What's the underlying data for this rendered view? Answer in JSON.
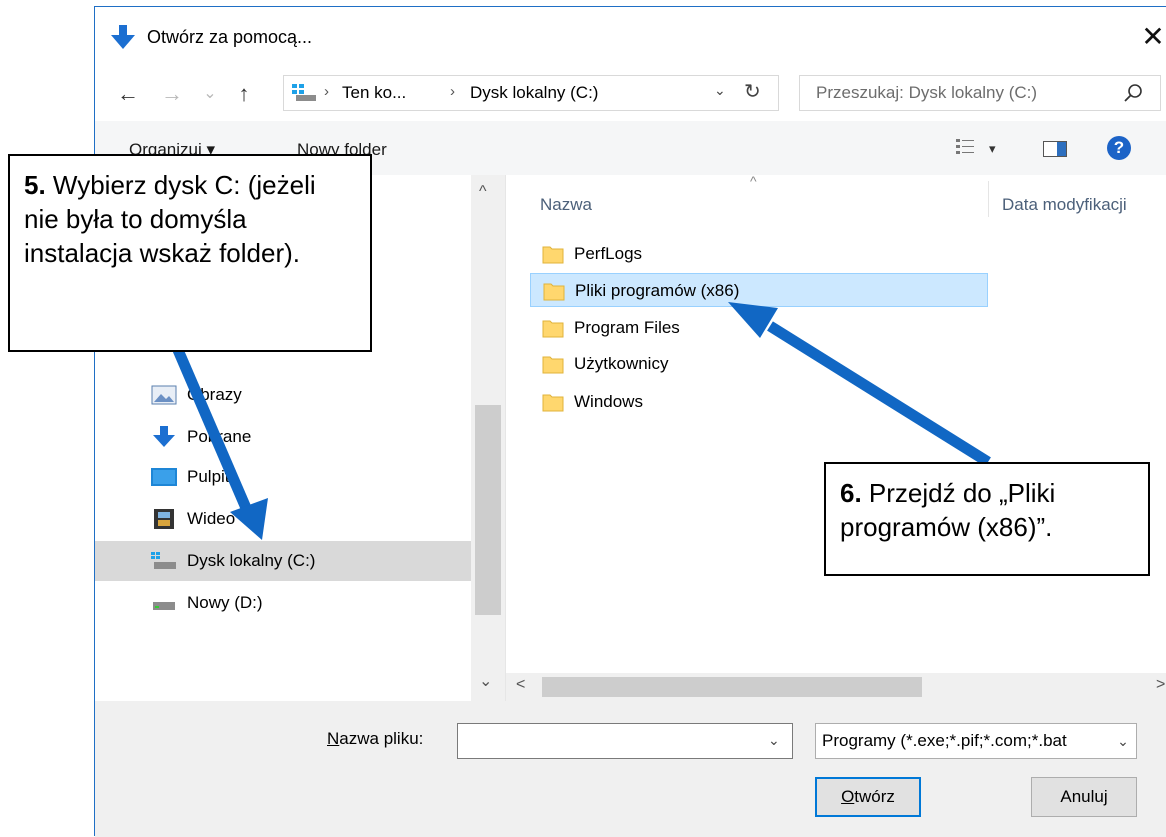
{
  "window": {
    "title": "Otwórz za pomocą...",
    "close_glyph": "✕"
  },
  "nav": {
    "back": "←",
    "forward": "→",
    "recent": "⌄",
    "up": "↑",
    "breadcrumbs": [
      "Ten ko...",
      "Dysk lokalny (C:)"
    ],
    "crumb_sep": "›",
    "dropdown_glyph": "⌄",
    "refresh_glyph": "↻"
  },
  "search": {
    "placeholder": "Przeszukaj: Dysk lokalny (C:)"
  },
  "toolbar": {
    "organize_label": "Organizuj ▾",
    "new_folder_label": "Nowy folder",
    "view_dropdown": "▾",
    "help_label": "?"
  },
  "navpane": {
    "items": [
      {
        "label": "Obrazy",
        "icon": "pictures-icon"
      },
      {
        "label": "Pobrane",
        "icon": "downloads-icon"
      },
      {
        "label": "Pulpit",
        "icon": "desktop-icon"
      },
      {
        "label": "Wideo",
        "icon": "video-icon"
      },
      {
        "label": "Dysk lokalny (C:)",
        "icon": "local-disk-icon",
        "selected": true
      },
      {
        "label": "Nowy (D:)",
        "icon": "drive-icon"
      }
    ],
    "scroll_up": "^",
    "scroll_down": "⌄"
  },
  "filelist": {
    "col_name": "Nazwa",
    "col_date": "Data modyfikacji",
    "sort_glyph": "^",
    "items": [
      {
        "label": "PerfLogs"
      },
      {
        "label": "Pliki programów (x86)",
        "selected": true
      },
      {
        "label": "Program Files"
      },
      {
        "label": "Użytkownicy"
      },
      {
        "label": "Windows"
      }
    ],
    "hscroll_left": "<",
    "hscroll_right": ">"
  },
  "bottom": {
    "filename_label_u": "N",
    "filename_label_rest": "azwa pliku:",
    "filename_value": "",
    "filename_dd": "⌄",
    "filetype_value": "Programy (*.exe;*.pif;*.com;*.bat",
    "filetype_dd": "⌄",
    "open_label_u": "O",
    "open_label_rest": "twórz",
    "cancel_label": "Anuluj"
  },
  "callouts": {
    "step5_num": "5.",
    "step5_text": " Wybierz dysk C: (jeżeli nie była to domyśla instalacja wskaż folder).",
    "step6_num": "6.",
    "step6_text": " Przejdź do „Pliki programów (x86)”."
  },
  "colors": {
    "accent": "#0078d7",
    "selection": "#cce8ff",
    "arrow": "#1167c4",
    "folder": "#ffd76e"
  }
}
